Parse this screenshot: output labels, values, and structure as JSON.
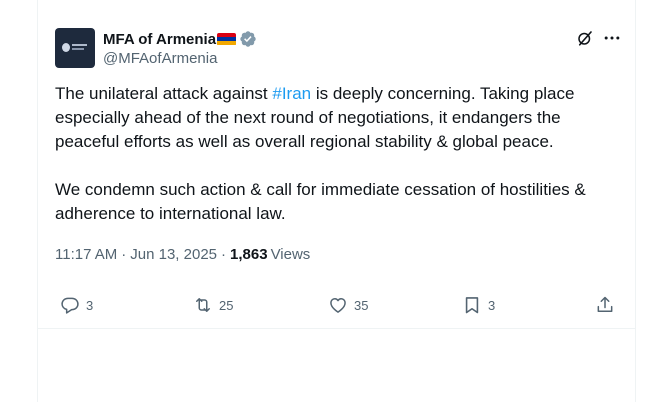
{
  "account": {
    "display_name": "MFA of Armenia",
    "handle": "@MFAofArmenia",
    "verified": true,
    "flag_colors": [
      "#d90012",
      "#0033a0",
      "#f2a800"
    ]
  },
  "tweet": {
    "text_part1_before_hashtag": "The unilateral attack against ",
    "hashtag": "#Iran",
    "text_part1_after_hashtag": " is deeply concerning. Taking place especially ahead of the next round of negotiations, it endangers the peaceful efforts as well as overall regional stability & global peace.",
    "text_part2": "We condemn such action & call for immediate cessation of hostilities & adherence to international law."
  },
  "meta": {
    "time": "11:17 AM",
    "separator": "·",
    "date": "Jun 13, 2025",
    "views_count": "1,863",
    "views_label": "Views"
  },
  "actions": {
    "replies": "3",
    "reposts": "25",
    "likes": "35",
    "bookmarks": "3"
  },
  "icons": {
    "grok": "grok-icon",
    "more": "more-icon",
    "reply": "reply-icon",
    "repost": "repost-icon",
    "like": "heart-icon",
    "bookmark": "bookmark-icon",
    "share": "share-icon",
    "verified": "verified-badge-icon"
  },
  "colors": {
    "text": "#0f1419",
    "secondary": "#536471",
    "link": "#1d9bf0",
    "border": "#eff3f4",
    "verified_badge": "#829aab"
  }
}
